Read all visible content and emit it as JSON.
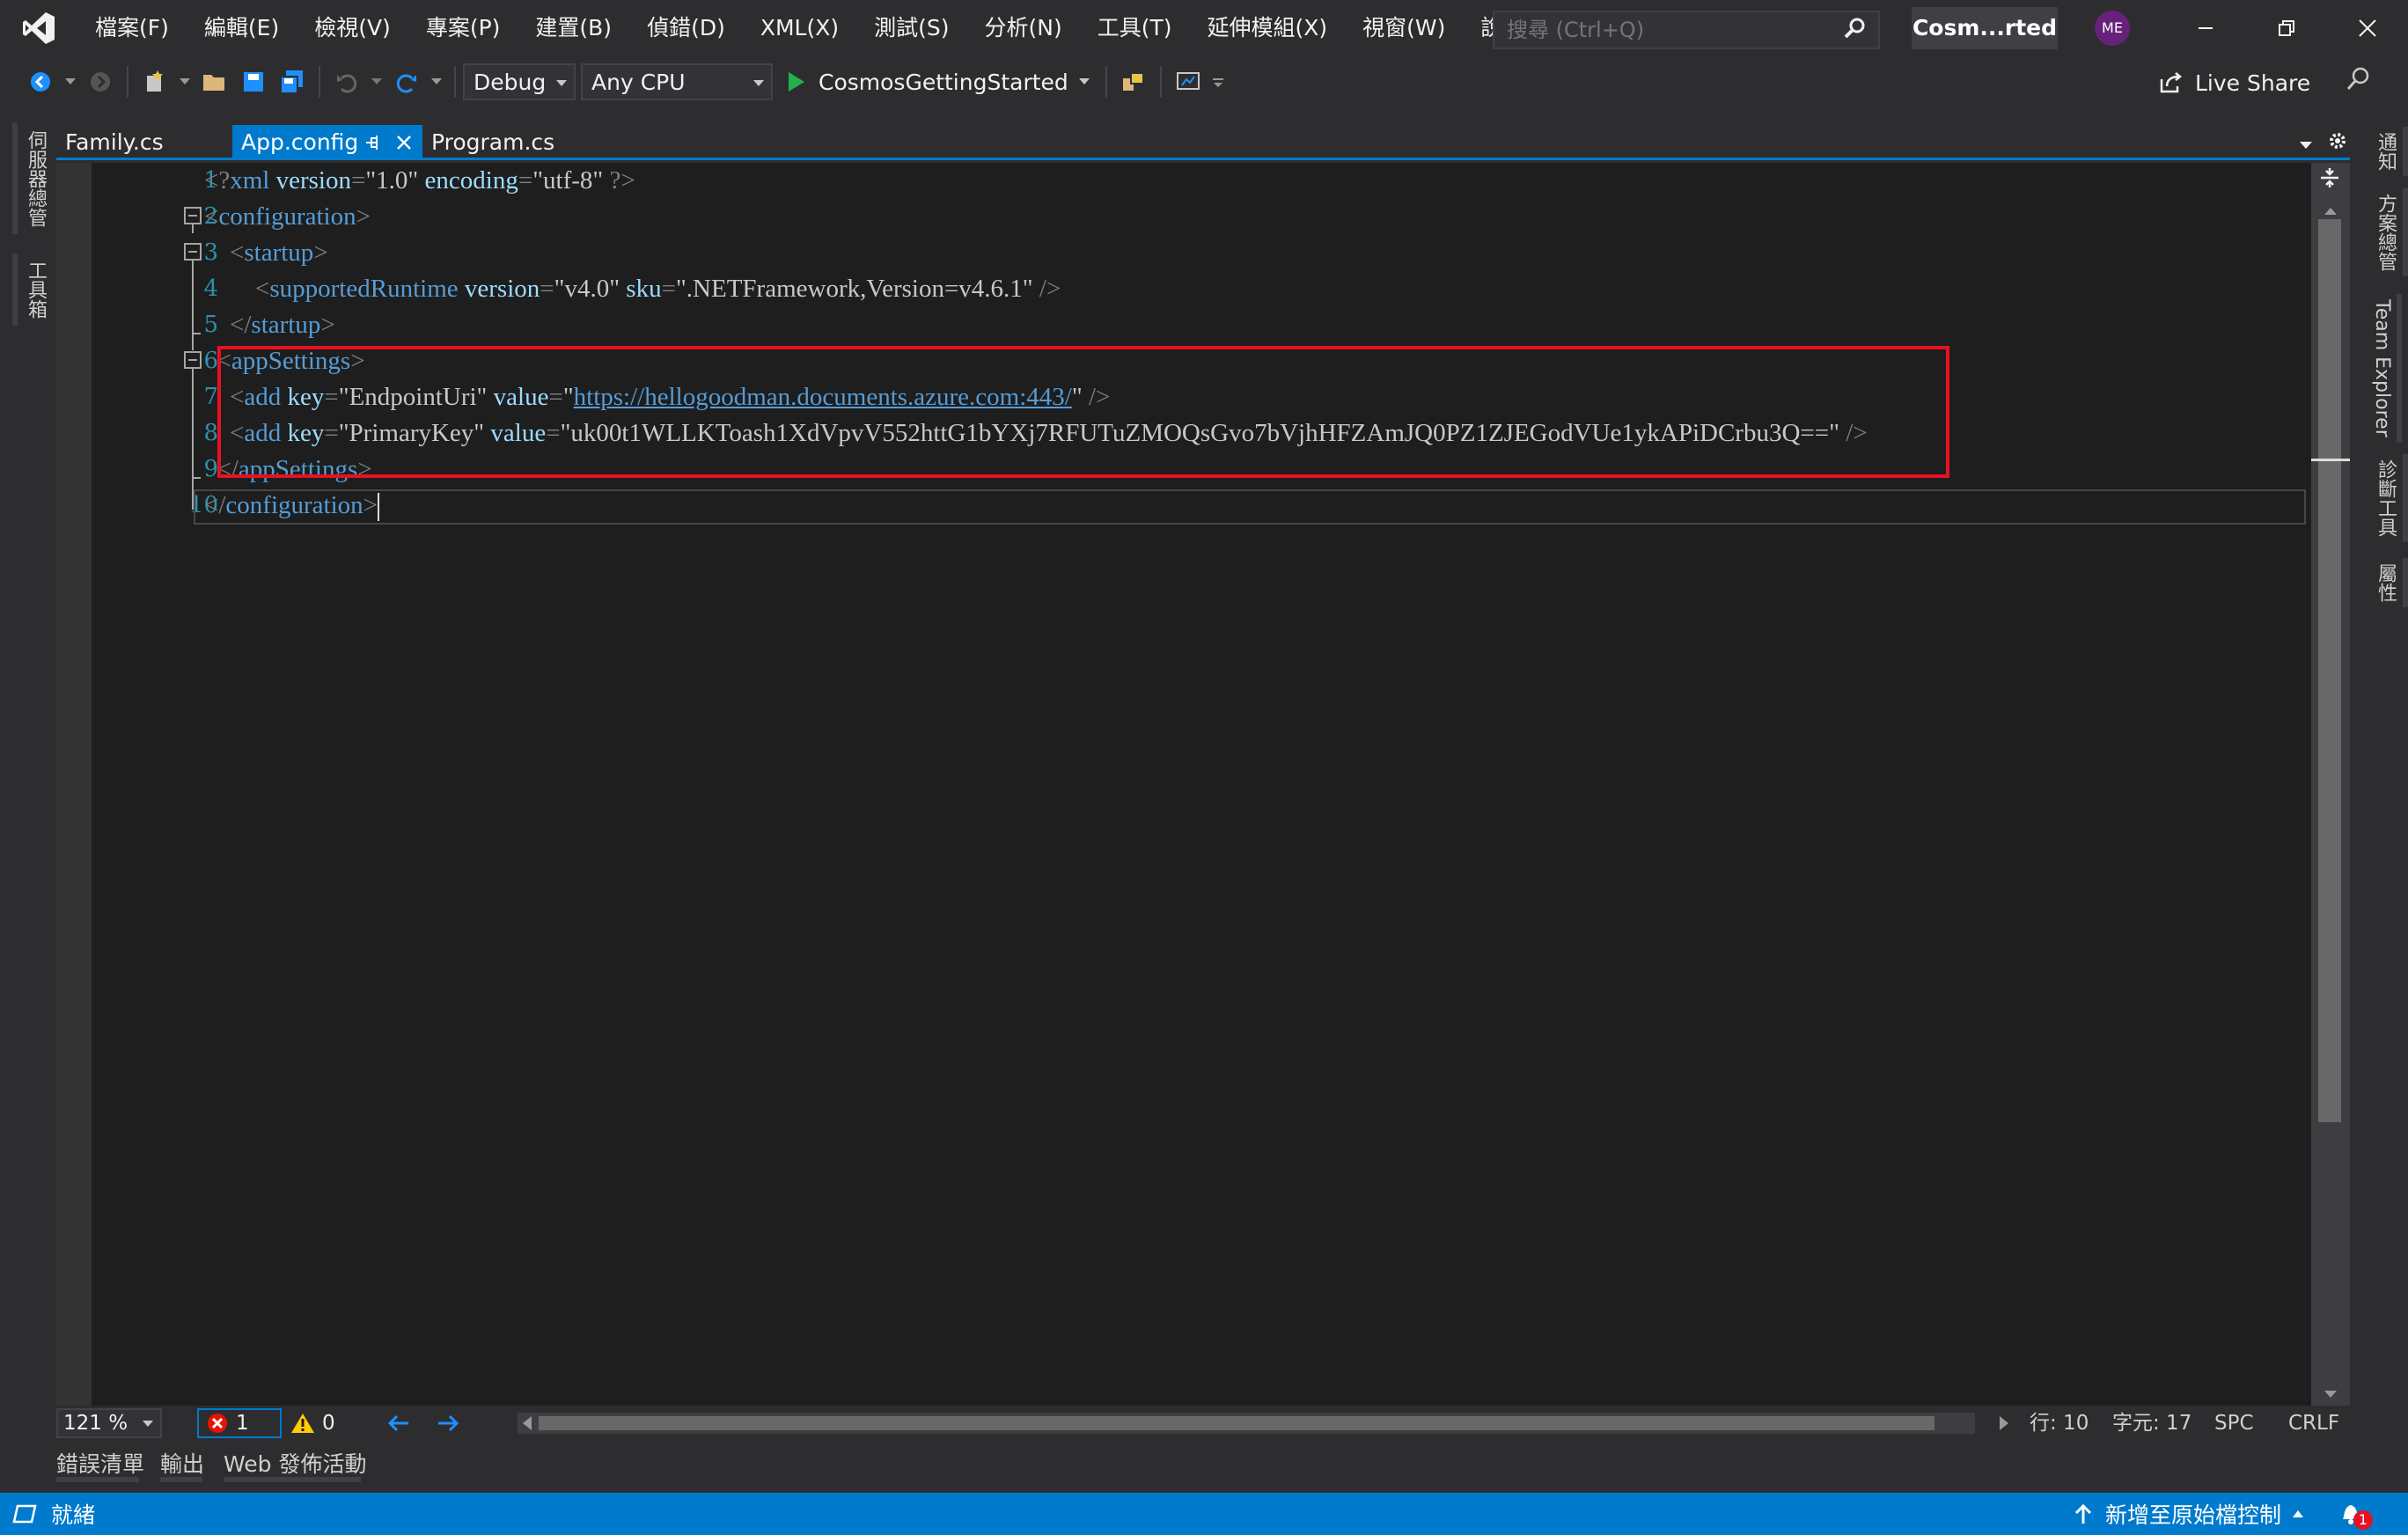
{
  "menu": {
    "items": [
      "檔案(F)",
      "編輯(E)",
      "檢視(V)",
      "專案(P)",
      "建置(B)",
      "偵錯(D)",
      "XML(X)",
      "測試(S)",
      "分析(N)",
      "工具(T)",
      "延伸模組(X)",
      "視窗(W)",
      "說明(H)"
    ],
    "search_placeholder": "搜尋 (Ctrl+Q)",
    "solution_name": "Cosm...rted",
    "avatar_initials": "ME"
  },
  "toolbar": {
    "config": "Debug",
    "platform": "Any CPU",
    "run_target": "CosmosGettingStarted",
    "live_share": "Live Share"
  },
  "left_panels": [
    "伺服器總管",
    "工具箱"
  ],
  "right_panels": [
    "通知",
    "方案總管",
    "Team Explorer",
    "診斷工具",
    "屬性"
  ],
  "tabs": [
    {
      "label": "Family.cs",
      "active": false
    },
    {
      "label": "App.config",
      "active": true
    },
    {
      "label": "Program.cs",
      "active": false
    }
  ],
  "editor": {
    "line_numbers": [
      "1",
      "2",
      "3",
      "4",
      "5",
      "6",
      "7",
      "8",
      "9",
      "10"
    ],
    "code": {
      "l1": {
        "pi_open": "<?",
        "tag": "xml",
        "a1": "version",
        "v1": "\"1.0\"",
        "a2": "encoding",
        "v2": "\"utf-8\"",
        "pi_close": "?>"
      },
      "l2": {
        "tag": "configuration"
      },
      "l3": {
        "tag": "startup"
      },
      "l4": {
        "tag": "supportedRuntime",
        "a1": "version",
        "v1": "\"v4.0\"",
        "a2": "sku",
        "v2": "\".NETFramework,Version=v4.6.1\""
      },
      "l5": {
        "tag": "startup"
      },
      "l6": {
        "tag": "appSettings"
      },
      "l7": {
        "tag": "add",
        "a1": "key",
        "v1": "\"EndpointUri\"",
        "a2": "value",
        "url": "https://hellogoodman.documents.azure.com:443/"
      },
      "l8": {
        "tag": "add",
        "a1": "key",
        "v1": "\"PrimaryKey\"",
        "a2": "value",
        "v2": "\"uk00t1WLLKToash1XdVpvV552httG1bYXj7RFUTuZMOQsGvo7bVjhHFZAmJQ0PZ1ZJEGodVUe1ykAPiDCrbu3Q==\""
      },
      "l9": {
        "tag": "appSettings"
      },
      "l10": {
        "tag": "configuration"
      }
    }
  },
  "editor_status": {
    "zoom": "121 %",
    "errors": "1",
    "warnings": "0",
    "line": "行: 10",
    "char": "字元: 17",
    "spc": "SPC",
    "eol": "CRLF"
  },
  "tool_tabs": [
    "錯誤清單",
    "輸出",
    "Web 發佈活動"
  ],
  "statusbar": {
    "ready": "就緒",
    "source_control": "新增至原始檔控制",
    "notifications": "1"
  },
  "colors": {
    "accent": "#007acc",
    "highlight_box": "#e81123"
  }
}
